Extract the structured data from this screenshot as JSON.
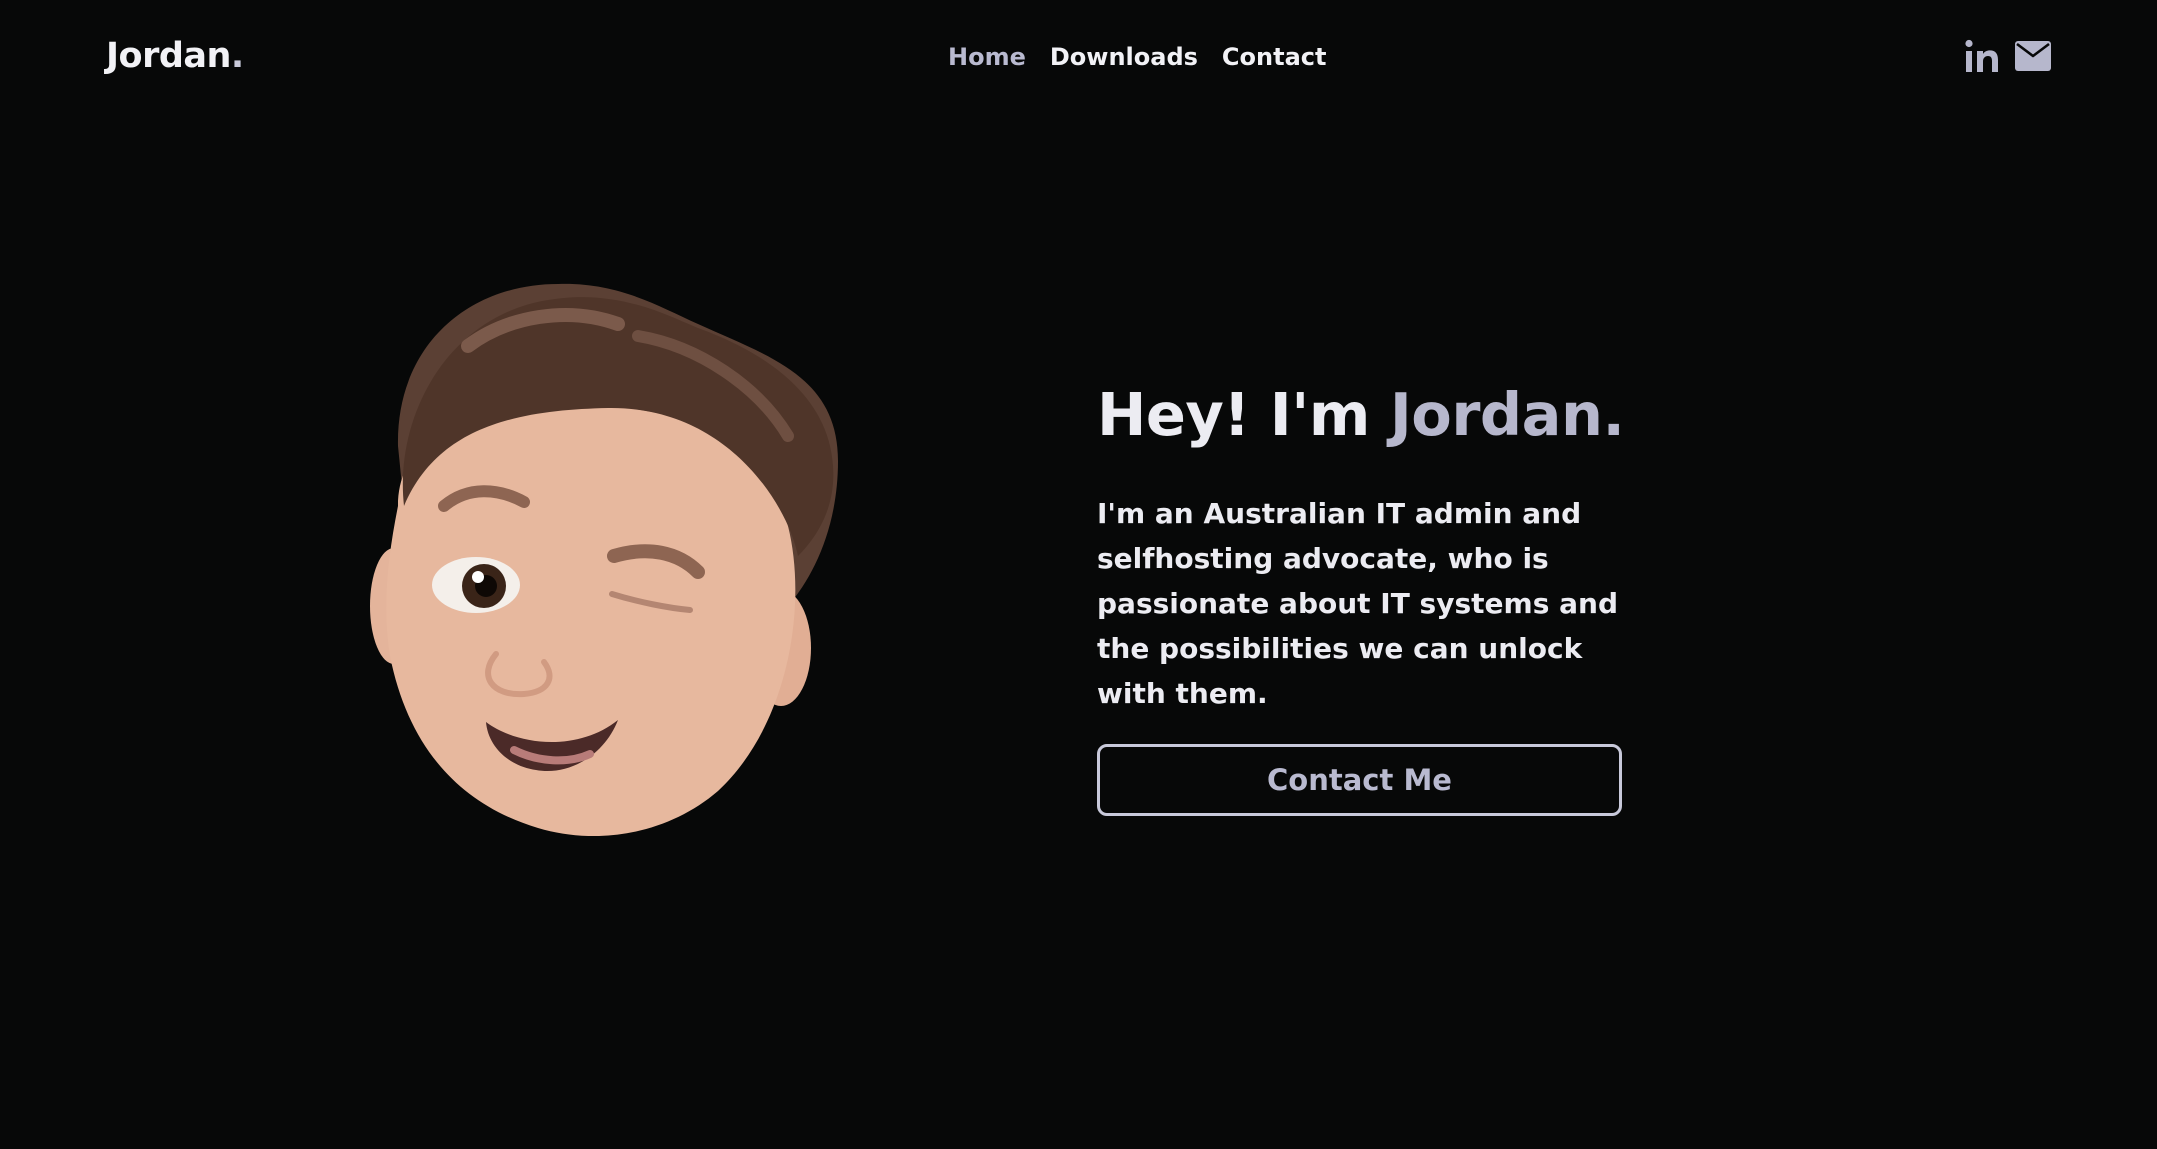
{
  "header": {
    "brand_name": "Jordan",
    "brand_dot": ".",
    "nav": [
      {
        "label": "Home",
        "active": true
      },
      {
        "label": "Downloads",
        "active": false
      },
      {
        "label": "Contact",
        "active": false
      }
    ],
    "social_icons": [
      "linkedin-icon",
      "envelope-icon"
    ]
  },
  "hero": {
    "greeting": "Hey! I'm ",
    "name": "Jordan.",
    "intro": "I'm an Australian IT admin and selfhosting advocate, who is passionate about IT systems and the possibilities we can unlock with them.",
    "cta_label": "Contact Me",
    "avatar": "winking-memoji-avatar"
  },
  "colors": {
    "background": "#070808",
    "text": "#ececf2",
    "accent": "#b6b7cc"
  }
}
